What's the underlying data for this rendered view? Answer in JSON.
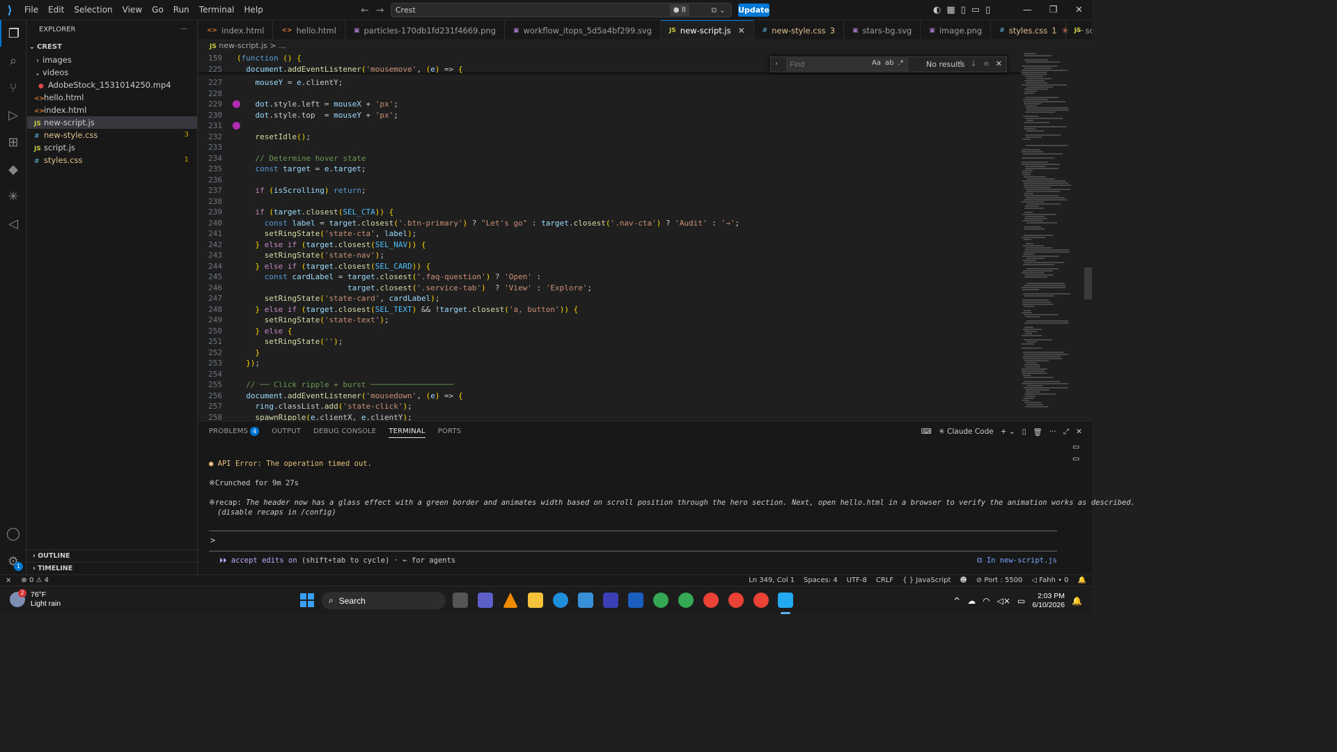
{
  "titlebar": {
    "menu": [
      "File",
      "Edit",
      "Selection",
      "View",
      "Go",
      "Run",
      "Terminal",
      "Help"
    ],
    "search_text": "Crest",
    "badge": "8",
    "update_label": "Update"
  },
  "sidebar": {
    "title": "EXPLORER",
    "more": "···",
    "root": "CREST",
    "items": [
      {
        "label": "images",
        "type": "folder",
        "expanded": false
      },
      {
        "label": "videos",
        "type": "folder",
        "expanded": true
      },
      {
        "label": "AdobeStock_1531014250.mp4",
        "type": "video"
      },
      {
        "label": "hello.html",
        "type": "html"
      },
      {
        "label": "index.html",
        "type": "html"
      },
      {
        "label": "new-script.js",
        "type": "js"
      },
      {
        "label": "new-style.css",
        "type": "css",
        "errors": "3"
      },
      {
        "label": "script.js",
        "type": "js"
      },
      {
        "label": "styles.css",
        "type": "css",
        "errors": "1"
      }
    ],
    "outline": "OUTLINE",
    "timeline": "TIMELINE"
  },
  "tabs": [
    {
      "label": "index.html",
      "icon": "<>"
    },
    {
      "label": "hello.html",
      "icon": "<>"
    },
    {
      "label": "particles-170db1fd231f4669.png",
      "icon": "img"
    },
    {
      "label": "workflow_itops_5d5a4bf299.svg",
      "icon": "img"
    },
    {
      "label": "new-script.js",
      "icon": "JS",
      "active": true
    },
    {
      "label": "new-style.css",
      "icon": "#",
      "count": "3"
    },
    {
      "label": "stars-bg.svg",
      "icon": "img"
    },
    {
      "label": "image.png",
      "icon": "img"
    },
    {
      "label": "styles.css",
      "icon": "#",
      "count": "1"
    },
    {
      "label": "script.js",
      "icon": "JS"
    }
  ],
  "breadcrumb": {
    "file": "new-script.js",
    "rest": "> ..."
  },
  "find": {
    "placeholder": "Find",
    "results": "No results"
  },
  "code": [
    {
      "n": "159",
      "t": "(function () {"
    },
    {
      "n": "225",
      "t": "  document.addEventListener('mousemove', (e) => {"
    },
    {
      "n": "227",
      "t": "    mouseY = e.clientY;"
    },
    {
      "n": "228",
      "t": ""
    },
    {
      "n": "229",
      "t": "    dot.style.left = mouseX + 'px';"
    },
    {
      "n": "230",
      "t": "    dot.style.top  = mouseY + 'px';"
    },
    {
      "n": "231",
      "t": ""
    },
    {
      "n": "232",
      "t": "    resetIdle();"
    },
    {
      "n": "233",
      "t": ""
    },
    {
      "n": "234",
      "t": "    // Determine hover state"
    },
    {
      "n": "235",
      "t": "    const target = e.target;"
    },
    {
      "n": "236",
      "t": ""
    },
    {
      "n": "237",
      "t": "    if (isScrolling) return;"
    },
    {
      "n": "238",
      "t": ""
    },
    {
      "n": "239",
      "t": "    if (target.closest(SEL_CTA)) {"
    },
    {
      "n": "240",
      "t": "      const label = target.closest('.btn-primary') ? \"Let's go\" : target.closest('.nav-cta') ? 'Audit' : '→';"
    },
    {
      "n": "241",
      "t": "      setRingState('state-cta', label);"
    },
    {
      "n": "242",
      "t": "    } else if (target.closest(SEL_NAV)) {"
    },
    {
      "n": "243",
      "t": "      setRingState('state-nav');"
    },
    {
      "n": "244",
      "t": "    } else if (target.closest(SEL_CARD)) {"
    },
    {
      "n": "245",
      "t": "      const cardLabel = target.closest('.faq-question') ? 'Open' :"
    },
    {
      "n": "246",
      "t": "                        target.closest('.service-tab')  ? 'View' : 'Explore';"
    },
    {
      "n": "247",
      "t": "      setRingState('state-card', cardLabel);"
    },
    {
      "n": "248",
      "t": "    } else if (target.closest(SEL_TEXT) && !target.closest('a, button')) {"
    },
    {
      "n": "249",
      "t": "      setRingState('state-text');"
    },
    {
      "n": "250",
      "t": "    } else {"
    },
    {
      "n": "251",
      "t": "      setRingState('');"
    },
    {
      "n": "252",
      "t": "    }"
    },
    {
      "n": "253",
      "t": "  });"
    },
    {
      "n": "254",
      "t": ""
    },
    {
      "n": "255",
      "t": "  // ── Click ripple + burst ──────────────────"
    },
    {
      "n": "256",
      "t": "  document.addEventListener('mousedown', (e) => {"
    },
    {
      "n": "257",
      "t": "    ring.classList.add('state-click');"
    },
    {
      "n": "258",
      "t": "    spawnRipple(e.clientX, e.clientY);"
    }
  ],
  "panel": {
    "tabs": [
      "PROBLEMS",
      "OUTPUT",
      "DEBUG CONSOLE",
      "TERMINAL",
      "PORTS"
    ],
    "problems_count": "4",
    "terminal_name": "Claude Code",
    "lines": {
      "error": "API Error: The operation timed out.",
      "crunched": "Crunched for 9m 27s",
      "recap_label": "recap:",
      "recap_text": "The header now has a glass effect with a green border and animates width based on scroll position through the hero section. Next, open hello.html in a browser to verify the animation works as described.",
      "recap_hint": "(disable recaps in /config)",
      "prompt": ">",
      "footer_accent": "⏵⏵ accept edits on",
      "footer_rest": "(shift+tab to cycle) · ← for agents",
      "in_file": "In new-script.js"
    }
  },
  "statusbar": {
    "errors": "0",
    "warnings": "4",
    "position": "Ln 349, Col 1",
    "spaces": "Spaces: 4",
    "encoding": "UTF-8",
    "eol": "CRLF",
    "language": "JavaScript",
    "port": "Port : 5500",
    "fahh": "Fahh • 0"
  },
  "taskbar": {
    "weather_temp": "76°F",
    "weather_desc": "Light rain",
    "weather_badge": "2",
    "search": "Search",
    "time": "2:03 PM",
    "date": "6/10/2026"
  },
  "colors": {
    "accent": "#0078d4",
    "breakpoint": "#b32bb3",
    "warning": "#cca700"
  }
}
